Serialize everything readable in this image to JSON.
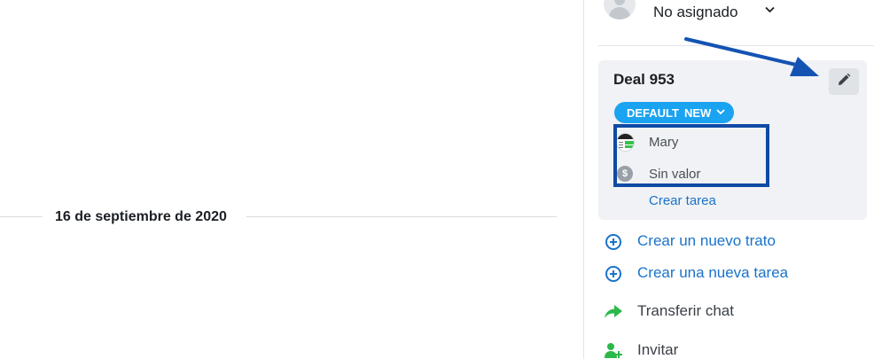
{
  "chat": {
    "date_separator": "16 de septiembre de 2020"
  },
  "sidebar": {
    "assignee": {
      "label": "No asignado",
      "avatar_icon": "user-placeholder-icon",
      "chevron_icon": "chevron-down-icon"
    },
    "deal": {
      "title": "Deal 953",
      "edit_icon": "pencil-icon",
      "pipeline": "DEFAULT",
      "stage": "NEW",
      "stage_color": "#1aa3f0",
      "owner": "Mary",
      "value": "Sin valor",
      "create_task_label": "Crear tarea"
    },
    "actions": [
      {
        "label": "Crear un nuevo trato",
        "icon": "plus-circle-icon"
      },
      {
        "label": "Crear una nueva tarea",
        "icon": "plus-circle-icon"
      },
      {
        "label": "Transferir chat",
        "icon": "share-arrow-icon"
      },
      {
        "label": "Invitar",
        "icon": "add-user-icon"
      }
    ]
  },
  "annotation": {
    "highlight_color": "#0f4aa5",
    "arrow_color": "#1553b3"
  },
  "colors": {
    "link": "#1a73c9",
    "card_background": "#f0f2f5",
    "transfer_icon": "#2cb84b"
  }
}
